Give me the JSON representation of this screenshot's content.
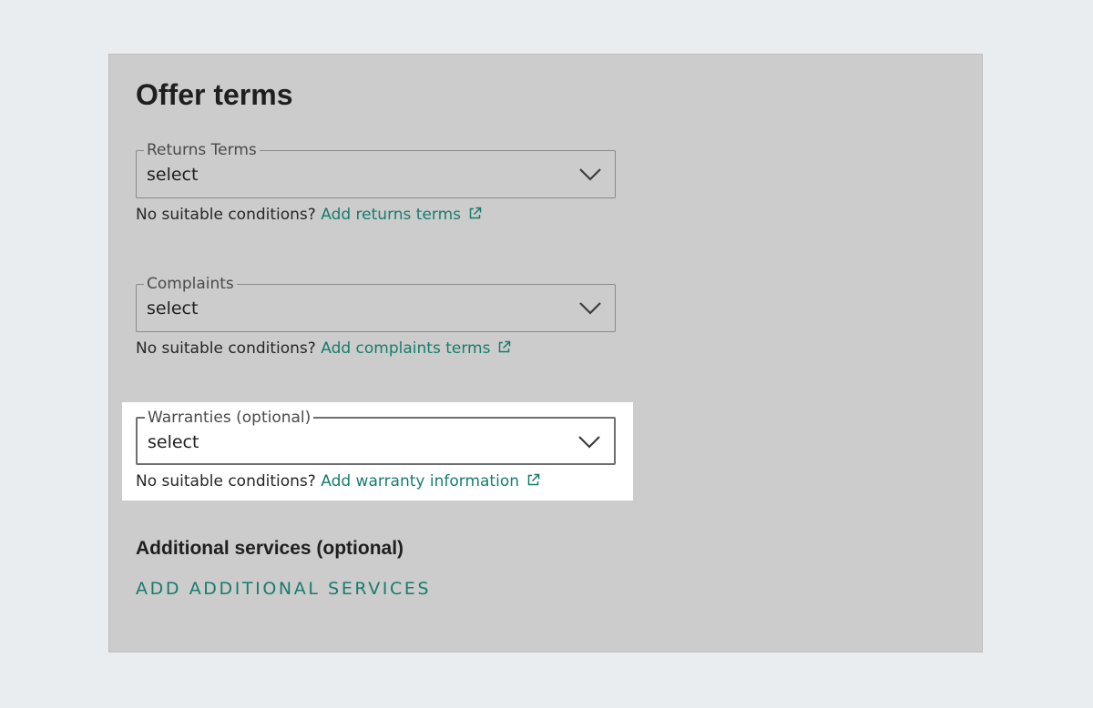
{
  "section": {
    "title": "Offer terms"
  },
  "returns": {
    "label": "Returns Terms",
    "value": "select",
    "hint": "No suitable conditions?",
    "link": "Add returns terms"
  },
  "complaints": {
    "label": "Complaints",
    "value": "select",
    "hint": "No suitable conditions?",
    "link": "Add complaints terms"
  },
  "warranties": {
    "label": "Warranties (optional)",
    "value": "select",
    "hint": "No suitable conditions?",
    "link": "Add warranty information"
  },
  "additional": {
    "title": "Additional services (optional)",
    "button_label": "ADD ADDITIONAL SERVICES"
  },
  "icons": {
    "dropdown": "chevron-down-icon",
    "external": "external-link-icon"
  },
  "colors": {
    "accent": "#177c6e",
    "panel": "#cccccc",
    "page": "#e9edf0",
    "highlight": "#ffffff"
  }
}
